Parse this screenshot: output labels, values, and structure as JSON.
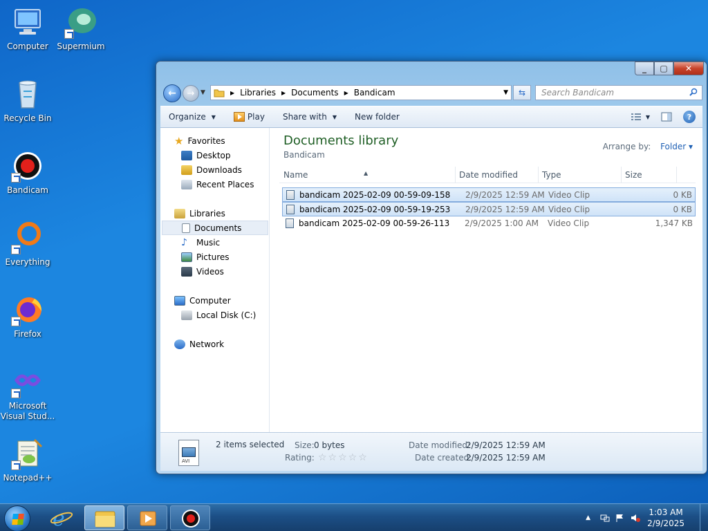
{
  "desktop": {
    "icons": [
      {
        "label": "Computer"
      },
      {
        "label": "Supermium"
      },
      {
        "label": "Recycle Bin"
      },
      {
        "label": "Bandicam"
      },
      {
        "label": "Everything"
      },
      {
        "label": "Firefox"
      },
      {
        "label": "Microsoft Visual Stud..."
      },
      {
        "label": "Notepad++"
      }
    ]
  },
  "window": {
    "address": {
      "crumbs": [
        "Libraries",
        "Documents",
        "Bandicam"
      ]
    },
    "search": {
      "placeholder": "Search Bandicam"
    },
    "toolbar": {
      "organize": "Organize",
      "play": "Play",
      "share": "Share with",
      "new_folder": "New folder"
    },
    "nav": {
      "favorites": "Favorites",
      "desktop": "Desktop",
      "downloads": "Downloads",
      "recent": "Recent Places",
      "libraries": "Libraries",
      "documents": "Documents",
      "music": "Music",
      "pictures": "Pictures",
      "videos": "Videos",
      "computer": "Computer",
      "local_disk": "Local Disk (C:)",
      "network": "Network"
    },
    "library": {
      "title": "Documents library",
      "subtitle": "Bandicam",
      "arrange_label": "Arrange by:",
      "arrange_value": "Folder"
    },
    "columns": {
      "name": "Name",
      "date": "Date modified",
      "type": "Type",
      "size": "Size"
    },
    "files": [
      {
        "name": "bandicam 2025-02-09 00-59-09-158",
        "date": "2/9/2025 12:59 AM",
        "type": "Video Clip",
        "size": "0 KB",
        "selected": true
      },
      {
        "name": "bandicam 2025-02-09 00-59-19-253",
        "date": "2/9/2025 12:59 AM",
        "type": "Video Clip",
        "size": "0 KB",
        "selected": true
      },
      {
        "name": "bandicam 2025-02-09 00-59-26-113",
        "date": "2/9/2025 1:00 AM",
        "type": "Video Clip",
        "size": "1,347 KB",
        "selected": false
      }
    ],
    "details": {
      "thumb_label": "AVI",
      "selected_count": "2 items selected",
      "size_label": "Size:",
      "size_value": "0 bytes",
      "rating_label": "Rating:",
      "date_mod_label": "Date modified:",
      "date_mod_value": "2/9/2025 12:59 AM",
      "date_created_label": "Date created:",
      "date_created_value": "2/9/2025 12:59 AM"
    }
  },
  "taskbar": {
    "time": "1:03 AM",
    "date": "2/9/2025"
  }
}
